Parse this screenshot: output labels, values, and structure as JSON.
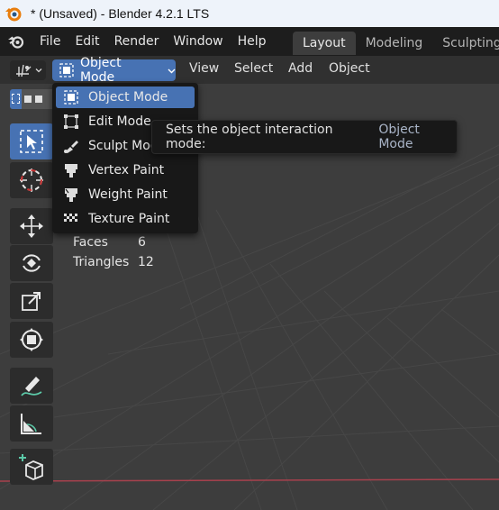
{
  "window": {
    "title": "* (Unsaved) - Blender 4.2.1 LTS"
  },
  "topbar": {
    "menus": [
      "File",
      "Edit",
      "Render",
      "Window",
      "Help"
    ],
    "workspaces": [
      {
        "label": "Layout",
        "active": true
      },
      {
        "label": "Modeling",
        "active": false
      },
      {
        "label": "Sculpting",
        "active": false
      }
    ]
  },
  "viewport_header": {
    "mode_label": "Object Mode",
    "menus": [
      "View",
      "Select",
      "Add",
      "Object"
    ]
  },
  "dropdown": {
    "items": [
      {
        "label": "Object Mode",
        "icon": "object-mode-icon",
        "selected": true
      },
      {
        "label": "Edit Mode",
        "icon": "edit-mode-icon",
        "selected": false
      },
      {
        "label": "Sculpt Mode",
        "icon": "sculpt-mode-icon",
        "selected": false
      },
      {
        "label": "Vertex Paint",
        "icon": "vertex-paint-icon",
        "selected": false
      },
      {
        "label": "Weight Paint",
        "icon": "weight-paint-icon",
        "selected": false
      },
      {
        "label": "Texture Paint",
        "icon": "texture-paint-icon",
        "selected": false
      }
    ]
  },
  "tooltip": {
    "text": "Sets the object interaction mode:",
    "value": "Object Mode"
  },
  "stats": {
    "faces_label": "Faces",
    "faces_value": "6",
    "triangles_label": "Triangles",
    "triangles_value": "12"
  },
  "toolbar": {
    "tools": [
      "select-box-icon",
      "cursor-icon",
      "move-icon",
      "rotate-icon",
      "scale-icon",
      "transform-icon",
      "annotate-icon",
      "measure-icon",
      "add-cube-icon"
    ]
  },
  "colors": {
    "accent": "#4772b3",
    "viewport_bg": "#3d3d3d",
    "x_axis": "#a8414d"
  }
}
